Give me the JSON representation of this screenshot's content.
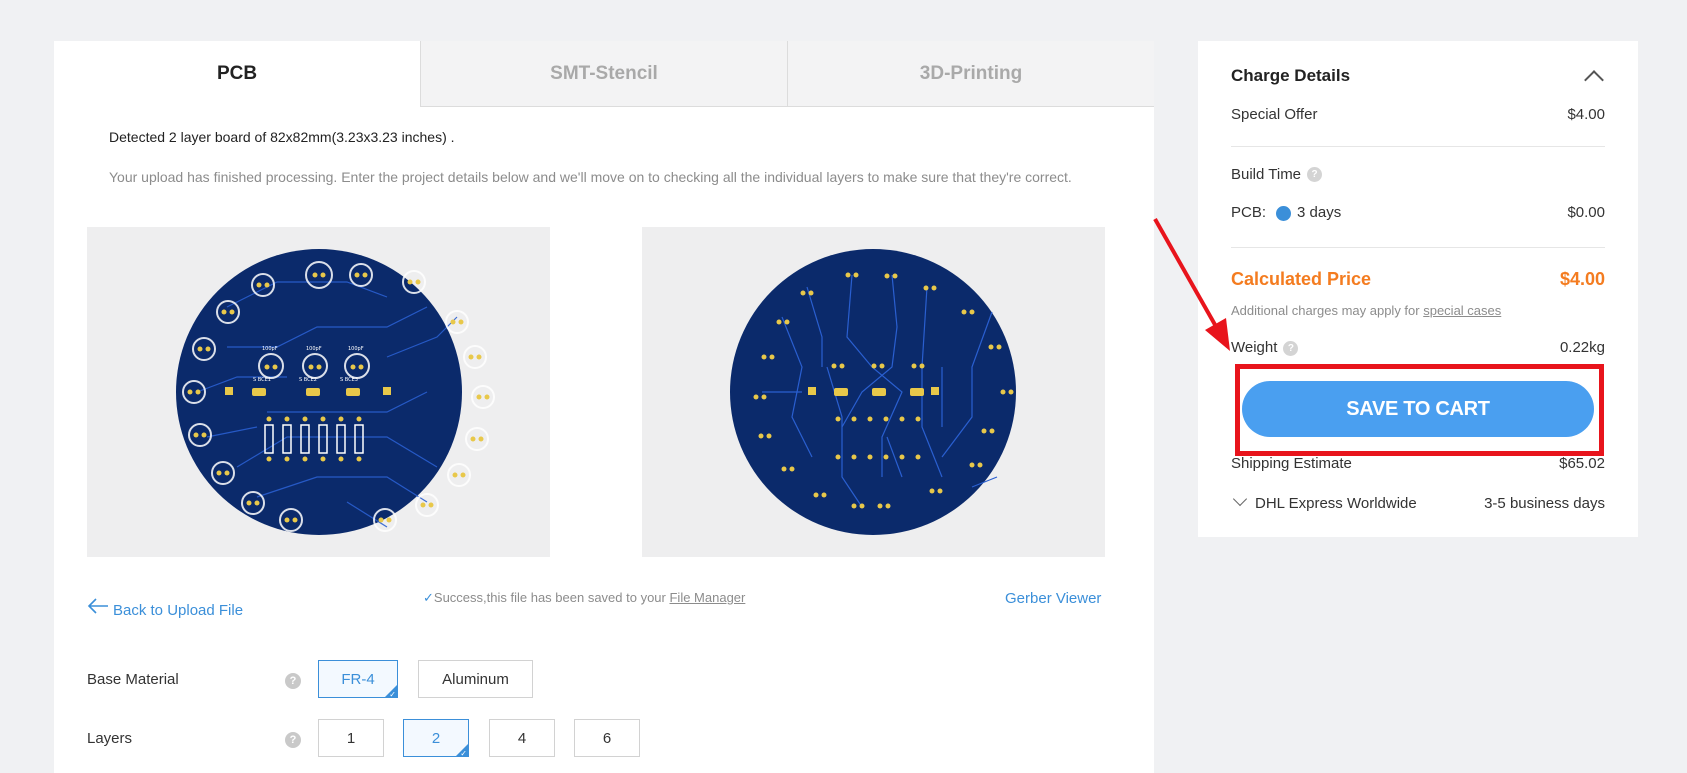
{
  "tabs": [
    {
      "label": "PCB",
      "active": true
    },
    {
      "label": "SMT-Stencil",
      "active": false
    },
    {
      "label": "3D-Printing",
      "active": false
    }
  ],
  "detected_text": "Detected 2 layer board of 82x82mm(3.23x3.23 inches) .",
  "upload_message": "Your upload has finished processing. Enter the project details below and we'll move on to checking all the individual layers to make sure that they're correct.",
  "links": {
    "back": "Back to Upload File",
    "success_prefix": "Success,this file has been saved to your ",
    "file_manager": "File Manager",
    "gerber_viewer": "Gerber Viewer"
  },
  "options": {
    "base_material": {
      "label": "Base Material",
      "choices": [
        "FR-4",
        "Aluminum"
      ],
      "selected": "FR-4"
    },
    "layers": {
      "label": "Layers",
      "choices": [
        "1",
        "2",
        "4",
        "6"
      ],
      "selected": "2"
    }
  },
  "pcb_silkscreen": [
    "100pF",
    "100pF",
    "100pF",
    "S BCE1",
    "S BCE2",
    "S BCE3"
  ],
  "charge_details": {
    "title": "Charge Details",
    "special_offer_label": "Special Offer",
    "special_offer_value": "$4.00",
    "build_time_label": "Build Time",
    "pcb_label": "PCB:",
    "pcb_option": "3 days",
    "pcb_value": "$0.00",
    "calculated_price_label": "Calculated Price",
    "calculated_price_value": "$4.00",
    "additional_prefix": "Additional charges may apply for ",
    "special_cases": "special cases",
    "weight_label": "Weight",
    "weight_value": "0.22kg",
    "save_button": "SAVE TO CART",
    "shipping_label": "Shipping Estimate",
    "shipping_value": "$65.02",
    "carrier": "DHL Express Worldwide",
    "carrier_time": "3-5 business days"
  },
  "colors": {
    "accent": "#3b8fd9",
    "price_orange": "#f47c20",
    "save_button": "#4a9ff0",
    "highlight_red": "#e8141c",
    "pcb_blue": "#0b2a6b"
  }
}
